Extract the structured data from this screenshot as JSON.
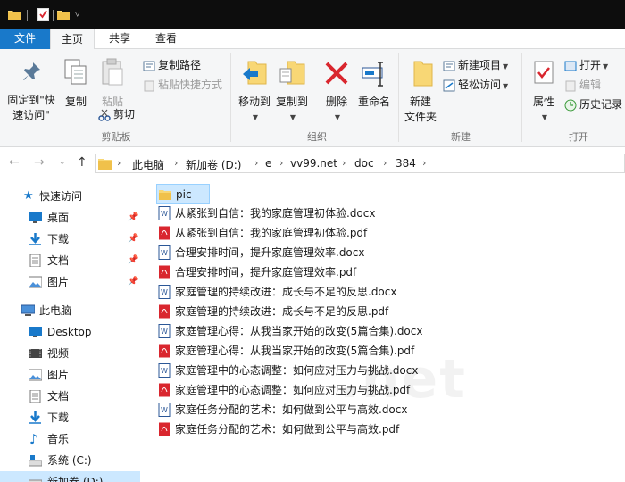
{
  "ribbon_tabs": {
    "file": "文件",
    "home": "主页",
    "share": "共享",
    "view": "查看"
  },
  "clipboard": {
    "pin_label_1": "固定到\"快",
    "pin_label_2": "速访问\"",
    "copy": "复制",
    "paste": "粘贴",
    "copy_path": "复制路径",
    "paste_shortcut": "粘贴快捷方式",
    "cut": "剪切",
    "group": "剪贴板"
  },
  "organize": {
    "move_to": "移动到",
    "copy_to": "复制到",
    "delete": "删除",
    "rename": "重命名",
    "group": "组织"
  },
  "new_group": {
    "new_folder_1": "新建",
    "new_folder_2": "文件夹",
    "new_item": "新建项目",
    "easy_access": "轻松访问",
    "group": "新建"
  },
  "open_group": {
    "properties": "属性",
    "open": "打开",
    "edit": "编辑",
    "history": "历史记录",
    "group": "打开"
  },
  "breadcrumbs": [
    "此电脑",
    "新加卷 (D:)",
    "e",
    "vv99.net",
    "doc",
    "384"
  ],
  "nav": {
    "quick_access": "快速访问",
    "qa_items": [
      "桌面",
      "下载",
      "文档",
      "图片"
    ],
    "this_pc": "此电脑",
    "pc_items": [
      "Desktop",
      "视频",
      "图片",
      "文档",
      "下载",
      "音乐",
      "系统 (C:)",
      "新加卷 (D:)"
    ]
  },
  "files": [
    {
      "name": "pic",
      "type": "folder"
    },
    {
      "name": "从紧张到自信：我的家庭管理初体验.docx",
      "type": "docx"
    },
    {
      "name": "从紧张到自信：我的家庭管理初体验.pdf",
      "type": "pdf"
    },
    {
      "name": "合理安排时间，提升家庭管理效率.docx",
      "type": "docx"
    },
    {
      "name": "合理安排时间，提升家庭管理效率.pdf",
      "type": "pdf"
    },
    {
      "name": "家庭管理的持续改进：成长与不足的反思.docx",
      "type": "docx"
    },
    {
      "name": "家庭管理的持续改进：成长与不足的反思.pdf",
      "type": "pdf"
    },
    {
      "name": "家庭管理心得：从我当家开始的改变(5篇合集).docx",
      "type": "docx"
    },
    {
      "name": "家庭管理心得：从我当家开始的改变(5篇合集).pdf",
      "type": "pdf"
    },
    {
      "name": "家庭管理中的心态调整：如何应对压力与挑战.docx",
      "type": "docx"
    },
    {
      "name": "家庭管理中的心态调整：如何应对压力与挑战.pdf",
      "type": "pdf"
    },
    {
      "name": "家庭任务分配的艺术：如何做到公平与高效.docx",
      "type": "docx"
    },
    {
      "name": "家庭任务分配的艺术：如何做到公平与高效.pdf",
      "type": "pdf"
    }
  ],
  "watermark": ".net",
  "colors": {
    "accent": "#1979ca",
    "selection": "#cce8ff",
    "folder": "#f8d775",
    "pdf": "#d9262e",
    "docx": "#2b5797"
  }
}
